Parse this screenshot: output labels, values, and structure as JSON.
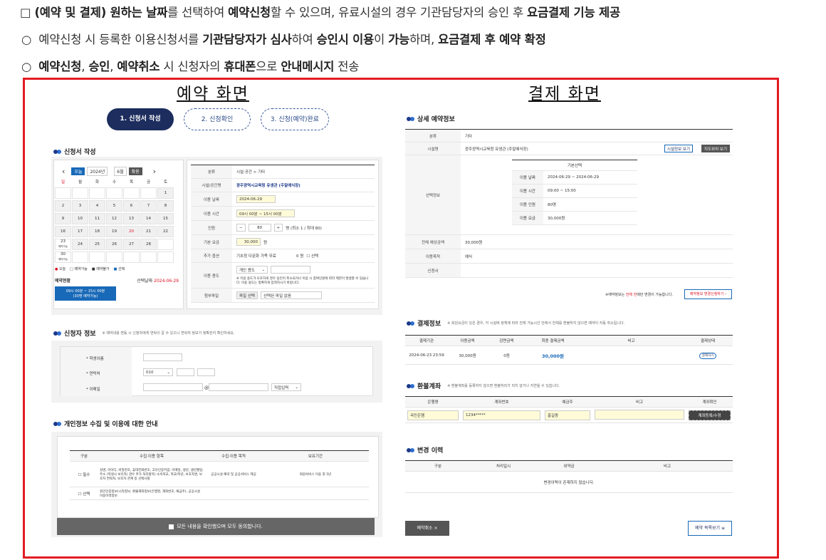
{
  "intro": {
    "line1": {
      "bullet": "□",
      "p1": "(예약 및 결제) 원하는 날짜",
      "p2": "를 선택하여 ",
      "p3": "예약신청",
      "p4": "할 수 있으며, 유료시설의 경우 기관담당자의 승인 후 ",
      "p5": "요금결제 기능 제공"
    },
    "line2": {
      "bullet": "○",
      "p1": "예약신청 시 등록한 이용신청서를 ",
      "p2": "기관담당자가 심사",
      "p3": "하여 ",
      "p4": "승인시 이용",
      "p5": "이 ",
      "p6": "가능",
      "p7": "하며, ",
      "p8": "요금결제 후 예약 확정"
    },
    "line3": {
      "bullet": "○",
      "p1": "예약신청",
      "p2": ", ",
      "p3": "승인",
      "p4": ", ",
      "p5": "예약취소",
      "p6": " 시 신청자의 ",
      "p7": "휴대폰",
      "p8": "으로 ",
      "p9": "안내메시지",
      "p10": " 전송"
    }
  },
  "sections": {
    "reserve": "예약 화면",
    "payment": "결제 화면"
  },
  "steps": [
    "1. 신청서 작성",
    "2. 신청확인",
    "3. 신청(예약)완료"
  ],
  "reserve": {
    "form_title": "신청서 작성",
    "calendar": {
      "today_btn": "오늘",
      "year": "2024년",
      "month": "6월",
      "go_btn": "확용",
      "weekdays": [
        "일",
        "월",
        "화",
        "수",
        "목",
        "금",
        "토"
      ],
      "weeks": [
        [
          "",
          "",
          "",
          "",
          "",
          "",
          "1"
        ],
        [
          "2",
          "3",
          "4",
          "5",
          "6",
          "7",
          "8"
        ],
        [
          "9",
          "10",
          "11",
          "12",
          "13",
          "14",
          "15"
        ],
        [
          "16",
          "17",
          "18",
          "19",
          "20",
          "21",
          "22"
        ],
        [
          "23",
          "24",
          "25",
          "26",
          "27",
          "28",
          "29"
        ],
        [
          "30",
          "",
          "",
          "",
          "",
          "",
          ""
        ]
      ],
      "cell_note_23": "예약가능",
      "cell_note_29": "예약가능",
      "cell_note_30": "예약가능",
      "legend": [
        "오늘",
        "예약가능",
        "예약불가",
        "선택"
      ],
      "status_label": "예약현황",
      "selected_label": "선택날짜",
      "selected_date": "2024-06-29",
      "slot": "09시 00분 ~ 15시 00분",
      "slot_sub": "(30명 예약가능)"
    },
    "fields": [
      {
        "k": "분류",
        "v": "시설·공간 > 기타"
      },
      {
        "k": "시설/공간명",
        "v": "광주광역시교육청 유생관 (주말예식장)"
      },
      {
        "k": "이용 날짜",
        "v": "2024-06-29"
      },
      {
        "k": "이용 시간",
        "v": "09시 00분 ~ 15시 00분"
      },
      {
        "k": "인원",
        "v": "80",
        "note": "명 (최소 1 / 최대 80)"
      },
      {
        "k": "기본 요금",
        "v": "30,000",
        "unit": "원"
      },
      {
        "k": "추가 옵션",
        "v": "기초청 다문화 가족 무료",
        "extra": "0 원",
        "chk": "선택"
      },
      {
        "k": "이용 용도",
        "v": "개인 용도",
        "note": "※ 이용 용도가 모호하게 경우 승인이 취소되거나 이용 시 참여인원에 따라 제한이 발생할 수 있습니다. 이용 용도는 정확하게 입력하시기 바랍니다."
      },
      {
        "k": "첨부파일",
        "btn": "파일 선택",
        "v": "선택된 파일 없음"
      }
    ],
    "applicant_title": "신청자 정보",
    "applicant_note": "※ 예약내용 변동 시 신청자에게 연락이 갈 수 있으니 연락처 정보가 정확한지 확인하세요.",
    "applicant_fields": {
      "name": "* 학생이름",
      "phone": "* 연락처",
      "email": "* 이메일",
      "phone_prefix": "010",
      "at": "@",
      "domain": "직접입력"
    },
    "privacy_title": "개인정보 수집 및 이용에 대한 안내",
    "privacy_headers": [
      "구분",
      "수집·이용 항목",
      "수집·이용 목적",
      "보유기간"
    ],
    "privacy_rows": [
      {
        "type": "필수",
        "items": "성명, 아이디, 비밀번호, 휴대전화번호, 고유인증키값, 이메일, 생년, 생년월일, 주소 (학생시 보유자) 경우 추가 처리항목) 소속학교, 학교/학년, 보호자명, 보호자 연락처, 보호자 관계 등 선택사항",
        "purpose": "공공시설 예약 및 공공서비스 제공",
        "period": "회원서비스 이용 후 5년"
      },
      {
        "type": "선택",
        "items": "원인인증정보(시작정보, 환불계좌정보(은행명, 계좌번호, 예금주), 공공시설 이용이력정보",
        "purpose": "",
        "period": ""
      }
    ],
    "agree_all": "모든 내용을 확인했으며 모두 동의합니다."
  },
  "payment": {
    "detail_title": "상세 예약정보",
    "detail": [
      {
        "k": "분류",
        "v": "기타"
      },
      {
        "k": "시설명",
        "v": "광주광역시교육청 유생관 (주말예식장)",
        "btn1": "시설정보 보기",
        "btn2": "지도위치 보기"
      },
      {
        "k": "선택정보",
        "sub_title": "기본선택",
        "sub": [
          {
            "k": "이용 날짜",
            "v": "2024-06-29 ~ 2024-06-29"
          },
          {
            "k": "이용 시간",
            "v": "09:00 ~ 15:00"
          },
          {
            "k": "이용 인원",
            "v": "80명"
          },
          {
            "k": "이용 요금",
            "v": "30,000원"
          }
        ]
      },
      {
        "k": "전체 예상금액",
        "v": "30,000원"
      },
      {
        "k": "이용목적",
        "v": "예식"
      },
      {
        "k": "신청서",
        "v": ""
      }
    ],
    "detail_note": "※예약정보는 ",
    "detail_note_red": "전체 전",
    "detail_note2": "에만 변경이 가능합니다.",
    "change_btn": "예약정보 변경신청하기 ›",
    "pay_title": "결제정보",
    "pay_note": "※ 회원요금이 있은 경우, 각 시설에 정책에 따라 전체 가능시간 안에서 전체를 환불하지 않으면 예약이 자동 취소됩니다.",
    "pay_headers": [
      "결제기관",
      "이용금액",
      "감면금액",
      "최종 결제금액",
      "비고",
      "결제상태"
    ],
    "pay_row": [
      "2024-06-23 23:59",
      "30,000원",
      "0원",
      "30,000원",
      "",
      "결제하기"
    ],
    "refund_title": "환불계좌",
    "refund_note": "※ 환불계좌를 등록하지 않으면 환불처리가 되지 않거나 지연될 수 있습니다.",
    "refund_headers": [
      "은행명",
      "계좌번호",
      "예금주",
      "비고",
      "계좌확인"
    ],
    "refund_row": [
      "국민은행",
      "1234*****",
      "홍길동",
      "",
      "계좌등록/수정"
    ],
    "history_title": "변경 이력",
    "history_headers": [
      "구분",
      "처리일시",
      "위약금",
      "비고"
    ],
    "history_empty": "변경이력이 존재하지 않습니다.",
    "cancel_btn": "예약취소",
    "list_btn": "예약 목록보기"
  }
}
